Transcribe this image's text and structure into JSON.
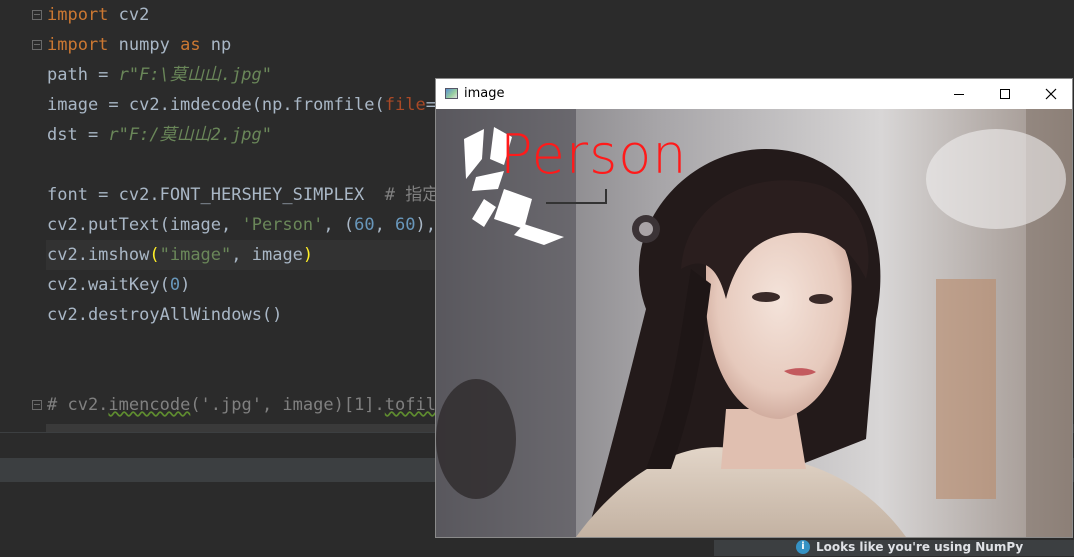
{
  "editor": {
    "lines": [
      {
        "tokens": [
          {
            "t": "import",
            "c": "kw"
          },
          {
            "t": " cv2",
            "c": ""
          }
        ]
      },
      {
        "tokens": [
          {
            "t": "import",
            "c": "kw"
          },
          {
            "t": " numpy ",
            "c": ""
          },
          {
            "t": "as",
            "c": "kw"
          },
          {
            "t": " np",
            "c": ""
          }
        ]
      },
      {
        "tokens": [
          {
            "t": "path = ",
            "c": ""
          },
          {
            "t": "r\"F:\\莫山山.jpg\"",
            "c": "str"
          }
        ]
      },
      {
        "tokens": [
          {
            "t": "image = cv2.imdecode(np.fromfile(",
            "c": ""
          },
          {
            "t": "file",
            "c": "param"
          },
          {
            "t": "=p",
            "c": ""
          }
        ]
      },
      {
        "tokens": [
          {
            "t": "dst = ",
            "c": ""
          },
          {
            "t": "r\"F:/莫山山2.jpg\"",
            "c": "str"
          }
        ]
      },
      {
        "tokens": []
      },
      {
        "tokens": [
          {
            "t": "font = cv2.FONT_HERSHEY_SIMPLEX  ",
            "c": ""
          },
          {
            "t": "# 指定",
            "c": "cmt"
          }
        ]
      },
      {
        "tokens": [
          {
            "t": "cv2.putText(image, ",
            "c": ""
          },
          {
            "t": "'Person'",
            "c": "str2"
          },
          {
            "t": ", (",
            "c": ""
          },
          {
            "t": "60",
            "c": "num"
          },
          {
            "t": ", ",
            "c": ""
          },
          {
            "t": "60",
            "c": "num"
          },
          {
            "t": "),",
            "c": ""
          }
        ]
      },
      {
        "tokens": [
          {
            "t": "cv2.imshow",
            "c": ""
          },
          {
            "t": "(",
            "c": "paren-hl"
          },
          {
            "t": "\"image\"",
            "c": "str2"
          },
          {
            "t": ", image",
            "c": ""
          },
          {
            "t": ")",
            "c": "paren-hl"
          }
        ]
      },
      {
        "tokens": [
          {
            "t": "cv2.waitKey(",
            "c": ""
          },
          {
            "t": "0",
            "c": "num"
          },
          {
            "t": ")",
            "c": ""
          }
        ]
      },
      {
        "tokens": [
          {
            "t": "cv2.destroyAllWindows()",
            "c": ""
          }
        ]
      },
      {
        "tokens": []
      },
      {
        "tokens": []
      },
      {
        "tokens": [
          {
            "t": "# cv2.",
            "c": "cmt"
          },
          {
            "t": "imencode",
            "c": "cmt squig"
          },
          {
            "t": "('.jpg', image)[1].",
            "c": "cmt"
          },
          {
            "t": "tofile",
            "c": "cmt squig"
          }
        ]
      }
    ]
  },
  "image_window": {
    "title": "image",
    "overlay_text": "Person"
  },
  "notification": {
    "text": "Looks like you're using NumPy"
  },
  "colors": {
    "editor_bg": "#2b2b2b",
    "keyword": "#cc7832",
    "string": "#6a8759",
    "number": "#6897bb",
    "comment": "#808080",
    "overlay_text": "#ff1a1a"
  }
}
